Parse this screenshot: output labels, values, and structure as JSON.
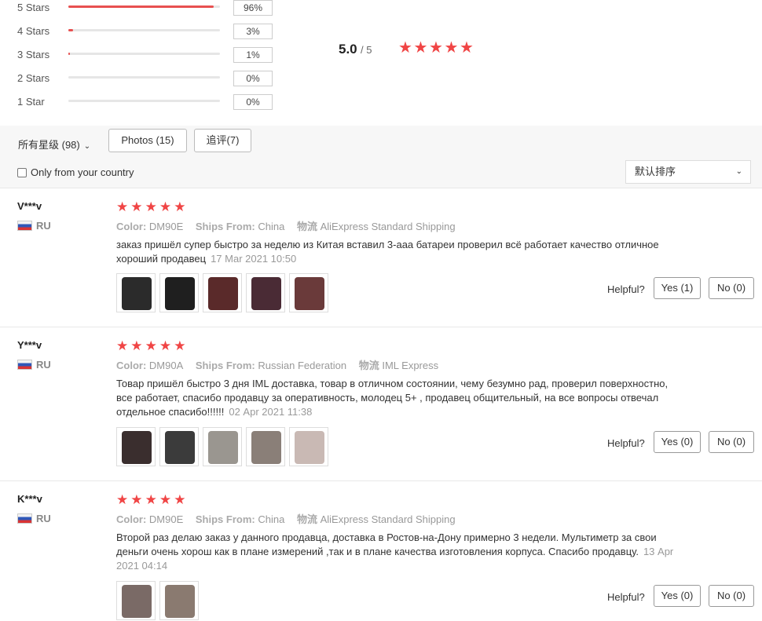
{
  "rating_distribution": [
    {
      "label": "5 Stars",
      "percent_text": "96%",
      "fill_fraction": 0.96
    },
    {
      "label": "4 Stars",
      "percent_text": "3%",
      "fill_fraction": 0.03
    },
    {
      "label": "3 Stars",
      "percent_text": "1%",
      "fill_fraction": 0.01
    },
    {
      "label": "2 Stars",
      "percent_text": "0%",
      "fill_fraction": 0.0
    },
    {
      "label": "1 Star",
      "percent_text": "0%",
      "fill_fraction": 0.0
    }
  ],
  "average": {
    "score": "5.0",
    "out_of": "/ 5",
    "stars_filled": 5
  },
  "filters": {
    "all_stars": "所有星级 (98)",
    "photos": "Photos (15)",
    "additional": "追评(7)",
    "only_country": "Only from your country",
    "sort": "默认排序"
  },
  "labels": {
    "color": "Color:",
    "ships_from": "Ships From:",
    "logistics": "物流",
    "helpful": "Helpful?"
  },
  "colors": {
    "star": "#f04545",
    "bar_fill": "#e85050"
  },
  "reviews": [
    {
      "user": "V***v",
      "country": "RU",
      "stars": 5,
      "color": "DM90E",
      "ships_from": "China",
      "logistics": "AliExpress Standard Shipping",
      "text": "заказ пришёл супер быстро за неделю из Китая вставил 3-ааа батареи проверил всё работает качество отличное хороший продавец",
      "date": "17 Mar 2021 10:50",
      "photo_count": 5,
      "yes": "Yes (1)",
      "no": "No (0)"
    },
    {
      "user": "Y***v",
      "country": "RU",
      "stars": 5,
      "color": "DM90A",
      "ships_from": "Russian Federation",
      "logistics": "IML Express",
      "text": "Товар пришёл быстро 3 дня IML доставка, товар в отличном состоянии, чему безумно рад, проверил поверхностно, все работает, спасибо продавцу за оперативность, молодец 5+ , продавец общительный, на все вопросы отвечал отдельное спасибо!!!!!!",
      "date": "02 Apr 2021 11:38",
      "photo_count": 5,
      "yes": "Yes (0)",
      "no": "No (0)"
    },
    {
      "user": "K***v",
      "country": "RU",
      "stars": 5,
      "color": "DM90E",
      "ships_from": "China",
      "logistics": "AliExpress Standard Shipping",
      "text": "Второй раз делаю заказ у данного продавца, доставка в Ростов-на-Дону примерно 3 недели. Мультиметр за свои деньги очень хорош как в плане измерений ,так и в плане качества изготовления корпуса. Спасибо продавцу.",
      "date": "13 Apr 2021 04:14",
      "photo_count": 2,
      "yes": "Yes (0)",
      "no": "No (0)"
    }
  ]
}
